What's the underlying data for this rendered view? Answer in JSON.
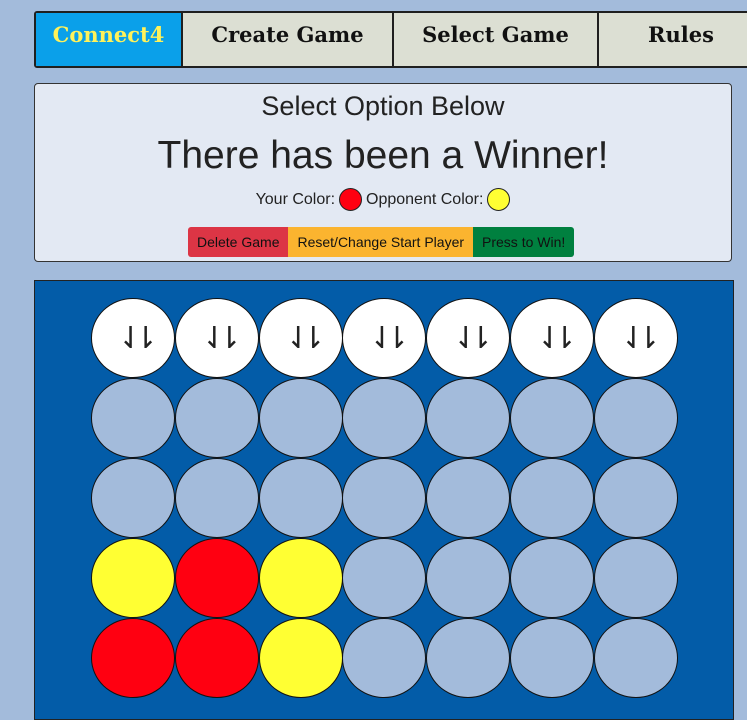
{
  "nav": {
    "tabs": [
      {
        "label": "Connect4"
      },
      {
        "label": "Create Game"
      },
      {
        "label": "Select Game"
      },
      {
        "label": "Rules"
      }
    ]
  },
  "panel": {
    "heading": "Select Option Below",
    "status": "There has been a Winner!",
    "your_color_label": "Your Color:",
    "opponent_color_label": "Opponent Color:",
    "your_color": "#ff0011",
    "opponent_color": "#ffff33",
    "buttons": {
      "delete": "Delete Game",
      "reset": "Reset/Change Start Player",
      "win": "Press to Win!"
    }
  },
  "colors": {
    "nav_active_bg": "#0aa0ea",
    "nav_active_text": "#fff25a",
    "board": "#035ca8",
    "empty_cell": "#a3bbdb",
    "drop_cell": "#ffffff",
    "delete_btn": "#dc3545",
    "reset_btn": "#fbb42f",
    "win_btn": "#00803f"
  },
  "board": {
    "drop_icon": "double-down-arrow-icon",
    "drop_glyph": "⇃⇂",
    "columns": 7,
    "rows": [
      [
        "empty",
        "empty",
        "empty",
        "empty",
        "empty",
        "empty",
        "empty"
      ],
      [
        "empty",
        "empty",
        "empty",
        "empty",
        "empty",
        "empty",
        "empty"
      ],
      [
        "yellow",
        "red",
        "yellow",
        "empty",
        "empty",
        "empty",
        "empty"
      ],
      [
        "red",
        "red",
        "yellow",
        "empty",
        "empty",
        "empty",
        "empty"
      ]
    ]
  }
}
